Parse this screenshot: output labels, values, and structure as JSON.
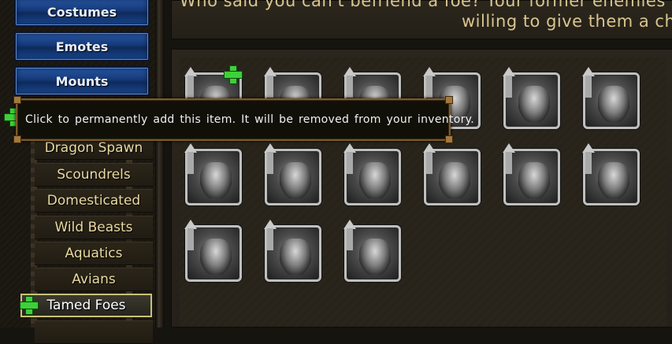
{
  "sidebar": {
    "top_buttons": [
      {
        "label": "Costumes"
      },
      {
        "label": "Emotes"
      },
      {
        "label": "Mounts"
      }
    ],
    "categories": [
      {
        "label": "Dragon Spawn"
      },
      {
        "label": "Scoundrels"
      },
      {
        "label": "Domesticated"
      },
      {
        "label": "Wild Beasts"
      },
      {
        "label": "Aquatics"
      },
      {
        "label": "Avians"
      },
      {
        "label": "Tamed Foes",
        "selected": true
      }
    ]
  },
  "description": {
    "line1": "Who said you can't befriend a foe? Your former enemies wi",
    "line2": "willing to give them a cha"
  },
  "tooltip": {
    "text": "Click to permanently add this item. It will be removed from your inventory."
  },
  "items": {
    "icons": [
      "tamed-foe-icon-1",
      "tamed-foe-icon-2",
      "tamed-foe-icon-3",
      "tamed-foe-icon-4",
      "tamed-foe-icon-5",
      "tamed-foe-icon-6",
      "tamed-foe-icon-7",
      "tamed-foe-icon-8",
      "tamed-foe-icon-9",
      "tamed-foe-icon-10",
      "tamed-foe-icon-11",
      "tamed-foe-icon-12",
      "tamed-foe-icon-13",
      "tamed-foe-icon-14",
      "tamed-foe-icon-15"
    ]
  },
  "colors": {
    "accent_green": "#3fcf3a",
    "text_gold": "#e9d9a0",
    "button_blue": "#153876"
  }
}
